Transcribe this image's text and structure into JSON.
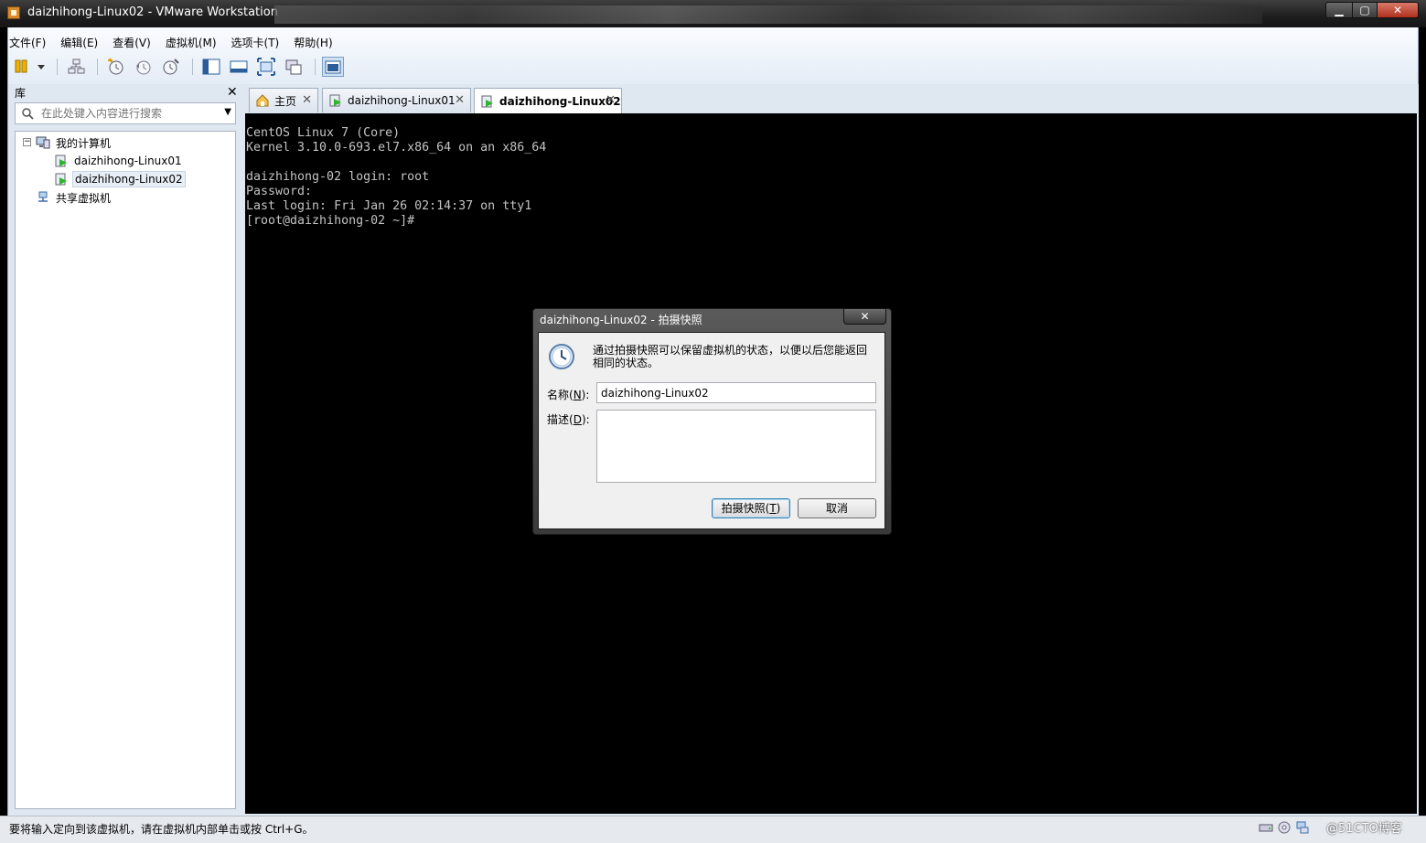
{
  "window": {
    "title": "daizhihong-Linux02 - VMware Workstation"
  },
  "menu": [
    "文件(F)",
    "编辑(E)",
    "查看(V)",
    "虚拟机(M)",
    "选项卡(T)",
    "帮助(H)"
  ],
  "library": {
    "title": "库",
    "search_placeholder": "在此处键入内容进行搜索",
    "tree": {
      "root": "我的计算机",
      "vms": [
        "daizhihong-Linux01",
        "daizhihong-Linux02"
      ],
      "shared": "共享虚拟机"
    }
  },
  "tabs": [
    {
      "label": "主页"
    },
    {
      "label": "daizhihong-Linux01"
    },
    {
      "label": "daizhihong-Linux02",
      "active": true
    }
  ],
  "console": {
    "lines": [
      "CentOS Linux 7 (Core)",
      "Kernel 3.10.0-693.el7.x86_64 on an x86_64",
      "",
      "daizhihong-02 login: root",
      "Password:",
      "Last login: Fri Jan 26 02:14:37 on tty1",
      "[root@daizhihong-02 ~]#"
    ]
  },
  "dialog": {
    "title": "daizhihong-Linux02 - 拍摄快照",
    "message": "通过拍摄快照可以保留虚拟机的状态，以便以后您能返回相同的状态。",
    "name_label_pre": "名称(",
    "name_label_key": "N",
    "name_label_post": "):",
    "name_value": "daizhihong-Linux02",
    "desc_label_pre": "描述(",
    "desc_label_key": "D",
    "desc_label_post": "):",
    "desc_value": "",
    "snap_label_pre": "拍摄快照(",
    "snap_label_key": "T",
    "snap_label_post": ")",
    "cancel_label": "取消"
  },
  "status": {
    "text": "要将输入定向到该虚拟机，请在虚拟机内部单击或按 Ctrl+G。",
    "watermark": "@51CTO博客"
  },
  "colors": {
    "accent": "#3c7fb1",
    "console_bg": "#000000",
    "console_fg": "#c4c4c4"
  }
}
